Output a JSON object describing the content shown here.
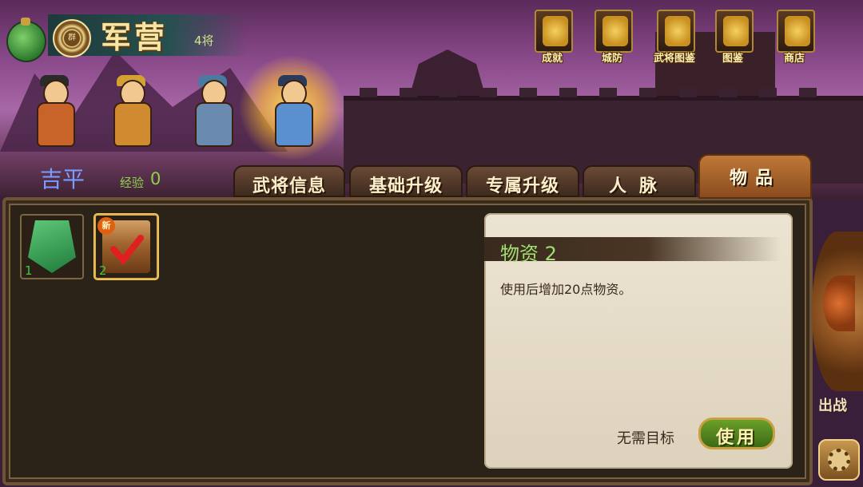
{
  "header": {
    "title": "军营",
    "general_count": "4将",
    "emblem_char": "群"
  },
  "top_menu": [
    {
      "label": "成就",
      "icon": "sword-icon"
    },
    {
      "label": "城防",
      "icon": "tower-icon"
    },
    {
      "label": "武将图鉴",
      "icon": "helmet-icon"
    },
    {
      "label": "图鉴",
      "icon": "scroll-icon"
    },
    {
      "label": "商店",
      "icon": "shop-icon"
    }
  ],
  "selected_hero": {
    "name": "吉平",
    "exp_label": "经验",
    "exp_value": "0"
  },
  "tabs": [
    {
      "label": "武将信息",
      "active": false
    },
    {
      "label": "基础升级",
      "active": false
    },
    {
      "label": "专属升级",
      "active": false
    },
    {
      "label": "人脉",
      "active": false
    },
    {
      "label": "物品",
      "active": true
    }
  ],
  "inventory": [
    {
      "icon": "soldier-token-icon",
      "quantity": "1",
      "is_new": false,
      "selected": false
    },
    {
      "icon": "supply-crate-icon",
      "quantity": "2",
      "is_new": true,
      "new_label": "新",
      "selected": true
    }
  ],
  "detail": {
    "item_name": "物资 2",
    "description": "使用后增加20点物资。",
    "target_text": "无需目标",
    "use_button": "使用"
  },
  "side": {
    "deploy_label": "出战"
  },
  "colors": {
    "accent_gold": "#f4d060",
    "exp_green": "#8fd04a",
    "hero_name_blue": "#7a9cff",
    "item_name_green": "#9fe070"
  }
}
